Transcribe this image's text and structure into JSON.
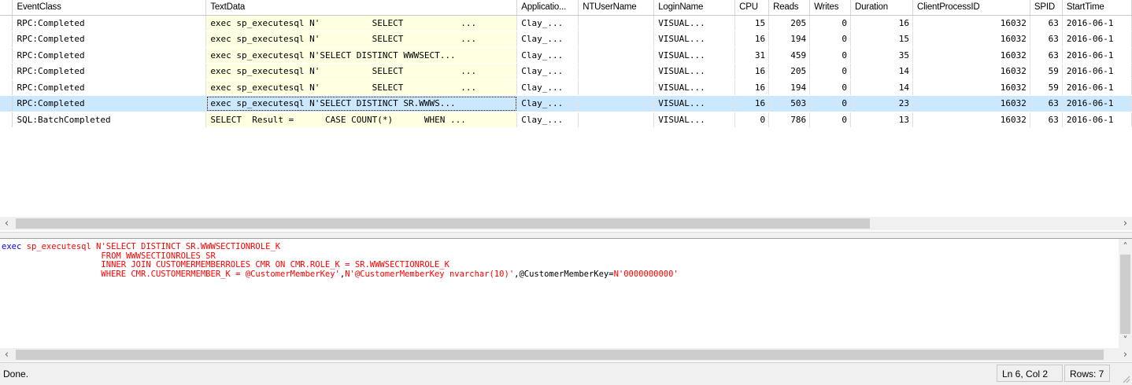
{
  "columns": [
    "EventClass",
    "TextData",
    "Applicatio...",
    "NTUserName",
    "LoginName",
    "CPU",
    "Reads",
    "Writes",
    "Duration",
    "ClientProcessID",
    "SPID",
    "StartTime"
  ],
  "rows": [
    {
      "event": "RPC:Completed",
      "text": "exec sp_executesql N'          SELECT           ...",
      "app": "Clay_...",
      "nt": "",
      "login": "VISUAL...",
      "cpu": "15",
      "reads": "205",
      "writes": "0",
      "duration": "16",
      "pid": "16032",
      "spid": "63",
      "start": "2016-06-1"
    },
    {
      "event": "RPC:Completed",
      "text": "exec sp_executesql N'          SELECT           ...",
      "app": "Clay_...",
      "nt": "",
      "login": "VISUAL...",
      "cpu": "16",
      "reads": "194",
      "writes": "0",
      "duration": "15",
      "pid": "16032",
      "spid": "63",
      "start": "2016-06-1"
    },
    {
      "event": "RPC:Completed",
      "text": "exec sp_executesql N'SELECT DISTINCT WWWSECT...",
      "app": "Clay_...",
      "nt": "",
      "login": "VISUAL...",
      "cpu": "31",
      "reads": "459",
      "writes": "0",
      "duration": "35",
      "pid": "16032",
      "spid": "63",
      "start": "2016-06-1"
    },
    {
      "event": "RPC:Completed",
      "text": "exec sp_executesql N'          SELECT           ...",
      "app": "Clay_...",
      "nt": "",
      "login": "VISUAL...",
      "cpu": "16",
      "reads": "205",
      "writes": "0",
      "duration": "14",
      "pid": "16032",
      "spid": "59",
      "start": "2016-06-1"
    },
    {
      "event": "RPC:Completed",
      "text": "exec sp_executesql N'          SELECT           ...",
      "app": "Clay_...",
      "nt": "",
      "login": "VISUAL...",
      "cpu": "16",
      "reads": "194",
      "writes": "0",
      "duration": "14",
      "pid": "16032",
      "spid": "59",
      "start": "2016-06-1"
    },
    {
      "event": "RPC:Completed",
      "text": "exec sp_executesql N'SELECT DISTINCT SR.WWWS...",
      "app": "Clay_...",
      "nt": "",
      "login": "VISUAL...",
      "cpu": "16",
      "reads": "503",
      "writes": "0",
      "duration": "23",
      "pid": "16032",
      "spid": "63",
      "start": "2016-06-1",
      "selected": true
    },
    {
      "event": "SQL:BatchCompleted",
      "text": "SELECT  Result =      CASE COUNT(*)      WHEN ...",
      "app": "Clay_...",
      "nt": "",
      "login": "VISUAL...",
      "cpu": "0",
      "reads": "786",
      "writes": "0",
      "duration": "13",
      "pid": "16032",
      "spid": "63",
      "start": "2016-06-1"
    }
  ],
  "detail": {
    "lines": [
      [
        {
          "t": "exec",
          "c": "kw"
        },
        {
          "t": " ",
          "c": "txt"
        },
        {
          "t": "sp_executesql",
          "c": "str"
        },
        {
          "t": " ",
          "c": "txt"
        },
        {
          "t": "N'SELECT DISTINCT SR.WWWSECTIONROLE_K",
          "c": "str"
        }
      ],
      [
        {
          "t": "                    FROM WWWSECTIONROLES SR",
          "c": "str"
        }
      ],
      [
        {
          "t": "                    INNER JOIN CUSTOMERMEMBERROLES CMR ON CMR.ROLE_K = SR.WWWSECTIONROLE_K",
          "c": "str"
        }
      ],
      [
        {
          "t": "                    WHERE CMR.CUSTOMERMEMBER_K = @CustomerMemberKey'",
          "c": "str"
        },
        {
          "t": ",",
          "c": "txt"
        },
        {
          "t": "N'@CustomerMemberKey nvarchar(10)'",
          "c": "str"
        },
        {
          "t": ",@CustomerMemberKey=",
          "c": "txt"
        },
        {
          "t": "N'0000000000'",
          "c": "str"
        }
      ]
    ]
  },
  "status": {
    "text": "Done.",
    "position": "Ln 6, Col 2",
    "rows": "Rows: 7"
  },
  "icons": {
    "left": "‹",
    "right": "›",
    "up": "˄",
    "down": "˅"
  }
}
